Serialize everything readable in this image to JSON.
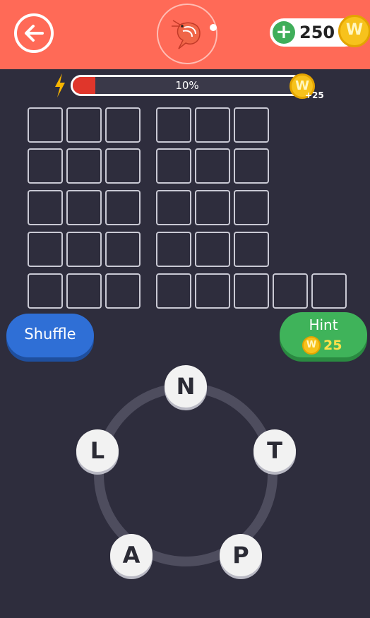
{
  "header": {
    "coins": "250",
    "coin_symbol": "W",
    "accent_color": "#ff6a57"
  },
  "progress": {
    "percent_label": "10%",
    "value": 0.1,
    "reward": "+25",
    "coin_symbol": "W"
  },
  "puzzle": {
    "words": [
      {
        "length": 3,
        "row": 0,
        "col": 0
      },
      {
        "length": 3,
        "row": 1,
        "col": 0
      },
      {
        "length": 3,
        "row": 2,
        "col": 0
      },
      {
        "length": 3,
        "row": 3,
        "col": 0
      },
      {
        "length": 3,
        "row": 4,
        "col": 0
      },
      {
        "length": 3,
        "row": 0,
        "col": 1
      },
      {
        "length": 3,
        "row": 1,
        "col": 1
      },
      {
        "length": 3,
        "row": 2,
        "col": 1
      },
      {
        "length": 3,
        "row": 3,
        "col": 1
      },
      {
        "length": 5,
        "row": 4,
        "col": 1
      }
    ]
  },
  "buttons": {
    "shuffle_label": "Shuffle",
    "hint_label": "Hint",
    "hint_cost": "25",
    "coin_symbol": "W"
  },
  "wheel": {
    "letters": [
      "N",
      "T",
      "P",
      "A",
      "L"
    ]
  }
}
